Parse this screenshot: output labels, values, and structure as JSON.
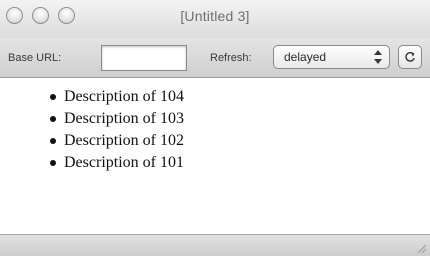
{
  "window": {
    "title": "[Untitled 3]"
  },
  "toolbar": {
    "base_url_label": "Base URL:",
    "base_url_value": "",
    "refresh_label": "Refresh:",
    "refresh_selected": "delayed",
    "reload_icon": "reload-icon"
  },
  "content": {
    "items": [
      {
        "label": "Description of 104"
      },
      {
        "label": "Description of 103"
      },
      {
        "label": "Description of 102"
      },
      {
        "label": "Description of 101"
      }
    ]
  },
  "icons": {
    "window_controls": [
      "close-icon",
      "minimize-icon",
      "zoom-icon"
    ],
    "select_arrows": "updown-arrows-icon",
    "resize": "resize-grip-icon"
  }
}
